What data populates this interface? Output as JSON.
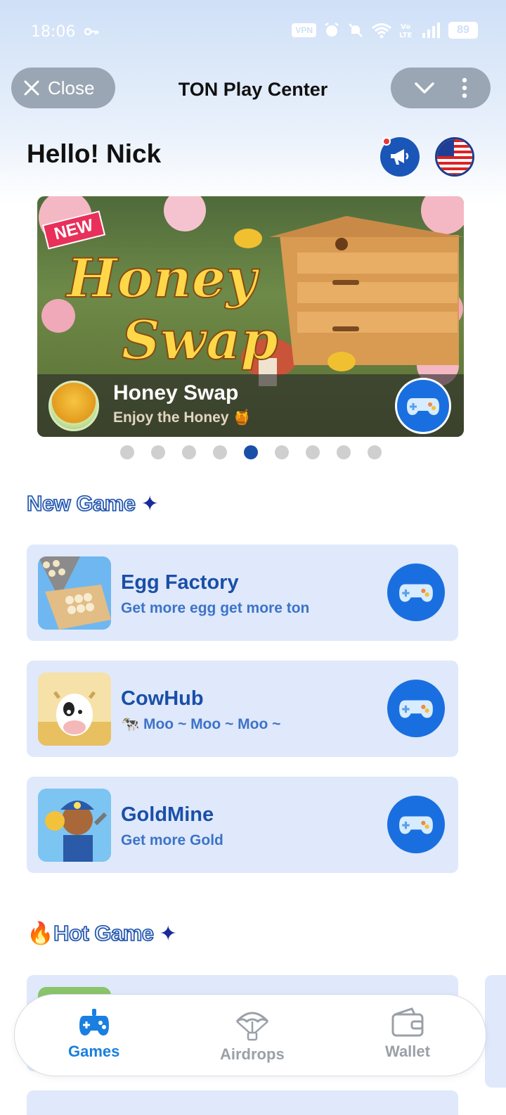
{
  "status_bar": {
    "time": "18:06",
    "vpn": "VPN",
    "battery": "89",
    "icons": [
      "key-icon",
      "alarm-icon",
      "mute-icon",
      "wifi-icon",
      "volte-icon",
      "signal-icon"
    ]
  },
  "header": {
    "close_label": "Close",
    "title": "TON Play Center"
  },
  "greeting": "Hello! Nick",
  "banner": {
    "title": "Honey Swap",
    "subtitle": "Enjoy the Honey 🍯",
    "art_badge": "NEW",
    "art_title_line1": "Honey",
    "art_title_line2": "Swap",
    "slide_count": 9,
    "active_slide": 5
  },
  "new_game_section": {
    "title": "New Game",
    "games": [
      {
        "title": "Egg Factory",
        "subtitle": "Get more egg get more ton"
      },
      {
        "title": "CowHub",
        "subtitle": "🐄 Moo ~  Moo ~  Moo ~"
      },
      {
        "title": "GoldMine",
        "subtitle": "Get more Gold"
      }
    ]
  },
  "hot_game_section": {
    "title": "Hot Game"
  },
  "bottom_nav": {
    "items": [
      {
        "label": "Games",
        "active": true
      },
      {
        "label": "Airdrops",
        "active": false
      },
      {
        "label": "Wallet",
        "active": false
      }
    ]
  },
  "colors": {
    "brand_blue": "#1a4fa8",
    "accent_blue": "#1a6fe0",
    "card_bg": "#dfe9fb",
    "nav_active": "#1a7fe0",
    "nav_inactive": "#9aa0a8"
  }
}
